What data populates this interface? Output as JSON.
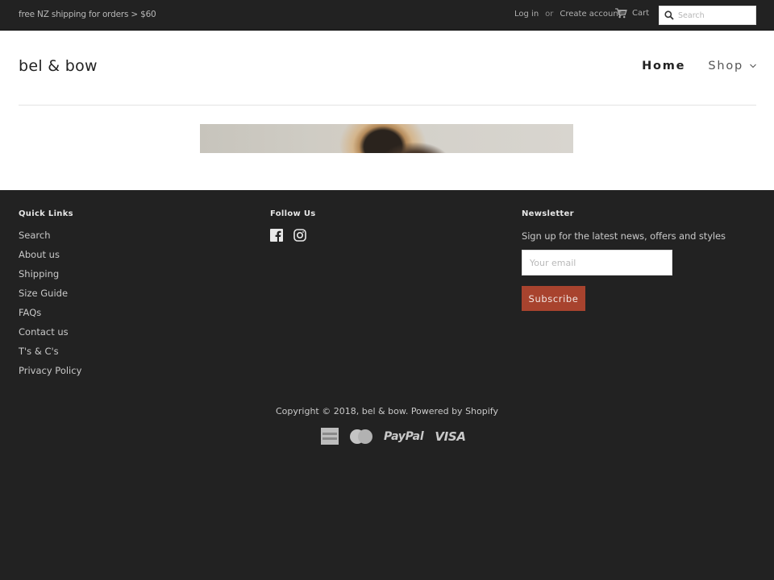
{
  "topbar": {
    "promo": "free NZ shipping for orders > $60",
    "login": "Log in",
    "or": "or",
    "create_account": "Create account",
    "cart": "Cart",
    "search_placeholder": "Search"
  },
  "header": {
    "logo": "bel & bow",
    "nav": [
      {
        "label": "Home",
        "active": true
      },
      {
        "label": "Shop",
        "has_dropdown": true
      }
    ]
  },
  "footer": {
    "quick_links": {
      "title": "Quick Links",
      "items": [
        "Search",
        "About us",
        "Shipping",
        "Size Guide",
        "FAQs",
        "Contact us",
        "T's & C's",
        "Privacy Policy"
      ]
    },
    "follow_us": {
      "title": "Follow Us",
      "icons": [
        "facebook-icon",
        "instagram-icon"
      ]
    },
    "newsletter": {
      "title": "Newsletter",
      "text": "Sign up for the latest news, offers and styles",
      "email_placeholder": "Your email",
      "subscribe_label": "Subscribe",
      "accent_color": "#a8432e"
    },
    "copyright_prefix": "Copyright © 2018,",
    "copyright_brand": "bel & bow",
    "powered_by": "Powered by Shopify",
    "payments": [
      "American Express",
      "MasterCard",
      "PayPal",
      "VISA"
    ],
    "payment_labels": {
      "paypal": "PayPal",
      "visa": "VISA"
    }
  }
}
